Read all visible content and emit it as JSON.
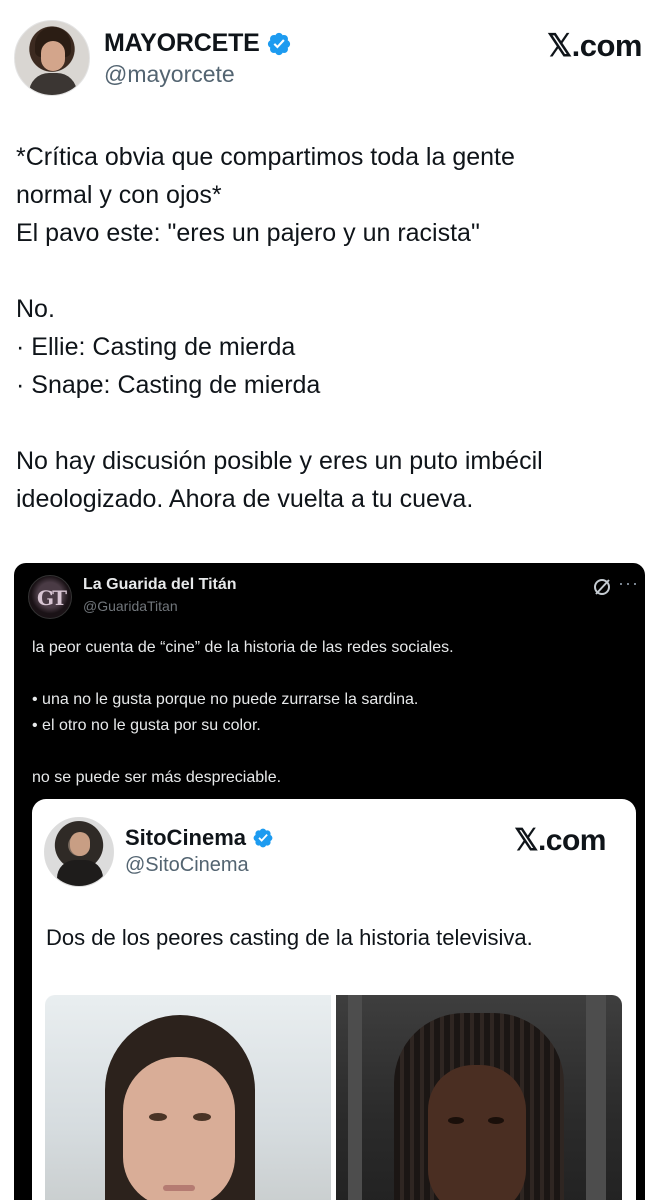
{
  "outer": {
    "author_name": "MAYORCETE",
    "author_handle": "@mayorcete",
    "brand": "𝕏.com",
    "text": "*Crítica obvia que compartimos toda la gente\nnormal y con ojos*\nEl pavo este: \"eres un pajero y un racista\"\n\nNo.\n· Ellie: Casting de mierda\n· Snape: Casting de mierda\n\nNo hay discusión posible y eres un puto imbécil\nideologizado. Ahora de vuelta a tu cueva."
  },
  "quote": {
    "avatar_initials": "GT",
    "author_name": "La Guarida del Titán",
    "author_handle": "@GuaridaTitan",
    "more": "···",
    "text": "la peor cuenta de “cine” de la historia de las redes sociales.\n\n• una no le gusta porque no puede zurrarse la sardina.\n• el otro no le gusta por su color.\n\nno se puede ser más despreciable."
  },
  "inner": {
    "author_name": "SitoCinema",
    "author_handle": "@SitoCinema",
    "brand": "𝕏.com",
    "text": "Dos de los peores casting de la historia televisiva."
  },
  "colors": {
    "verified_blue": "#1d9bf0",
    "card_black": "#000000",
    "handle_gray": "#536471"
  },
  "icons": {
    "verified": "verified-badge-icon",
    "grok": "grok-icon",
    "more": "more-options-icon"
  }
}
